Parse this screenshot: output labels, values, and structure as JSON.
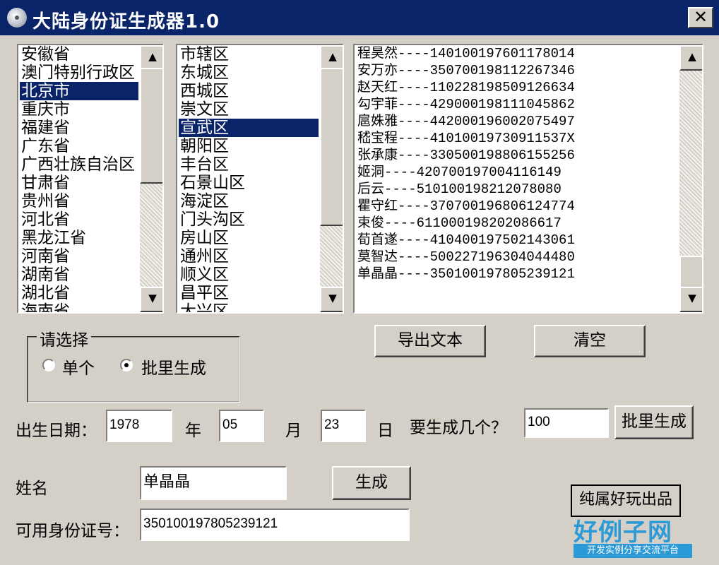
{
  "window": {
    "title": "大陆身份证生成器1.0",
    "close_glyph": "✕"
  },
  "provinces": {
    "items": [
      "安徽省",
      "澳门特别行政区",
      "北京市",
      "重庆市",
      "福建省",
      "广东省",
      "广西壮族自治区",
      "甘肃省",
      "贵州省",
      "河北省",
      "黑龙江省",
      "河南省",
      "湖南省",
      "湖北省",
      "海南省"
    ],
    "selected": "北京市"
  },
  "districts": {
    "items": [
      "市辖区",
      "东城区",
      "西城区",
      "崇文区",
      "宣武区",
      "朝阳区",
      "丰台区",
      "石景山区",
      "海淀区",
      "门头沟区",
      "房山区",
      "通州区",
      "顺义区",
      "昌平区",
      "大兴区"
    ],
    "selected": "宣武区"
  },
  "results": [
    "程昊然----140100197601178014",
    "安万亦----350700198112267346",
    "赵天红----110228198509126634",
    "勾宇菲----429000198111045862",
    "扈姝雅----442000196002075497",
    "嵇宝程----41010019730911537X",
    "张承康----330500198806155256",
    "姬洞----420700197004116149",
    "后云----510100198212078080",
    "瞿守红----370700196806124774",
    "束俊----611000198202086617",
    "荀首遂----410400197502143061",
    "莫智达----500227196304044480",
    "单晶晶----350100197805239121"
  ],
  "mode": {
    "legend": "请选择",
    "single": "单个",
    "batch": "批里生成",
    "selected": "batch"
  },
  "buttons": {
    "export": "导出文本",
    "clear": "清空",
    "batch_generate": "批里生成",
    "generate": "生成"
  },
  "birth": {
    "label": "出生日期：",
    "year": "1978",
    "year_unit": "年",
    "month": "05",
    "month_unit": "月",
    "day": "23",
    "day_unit": "日"
  },
  "count": {
    "label": "要生成几个？",
    "value": "100"
  },
  "name": {
    "label": "姓名",
    "value": "单晶晶"
  },
  "id_number": {
    "label": "可用身份证号：",
    "value": "350100197805239121"
  },
  "credit": "纯属好玩出品",
  "watermark": {
    "brand": "好例子网",
    "tagline": "开发实例分享交流平台"
  },
  "icons": {
    "up": "▲",
    "down": "▼"
  }
}
